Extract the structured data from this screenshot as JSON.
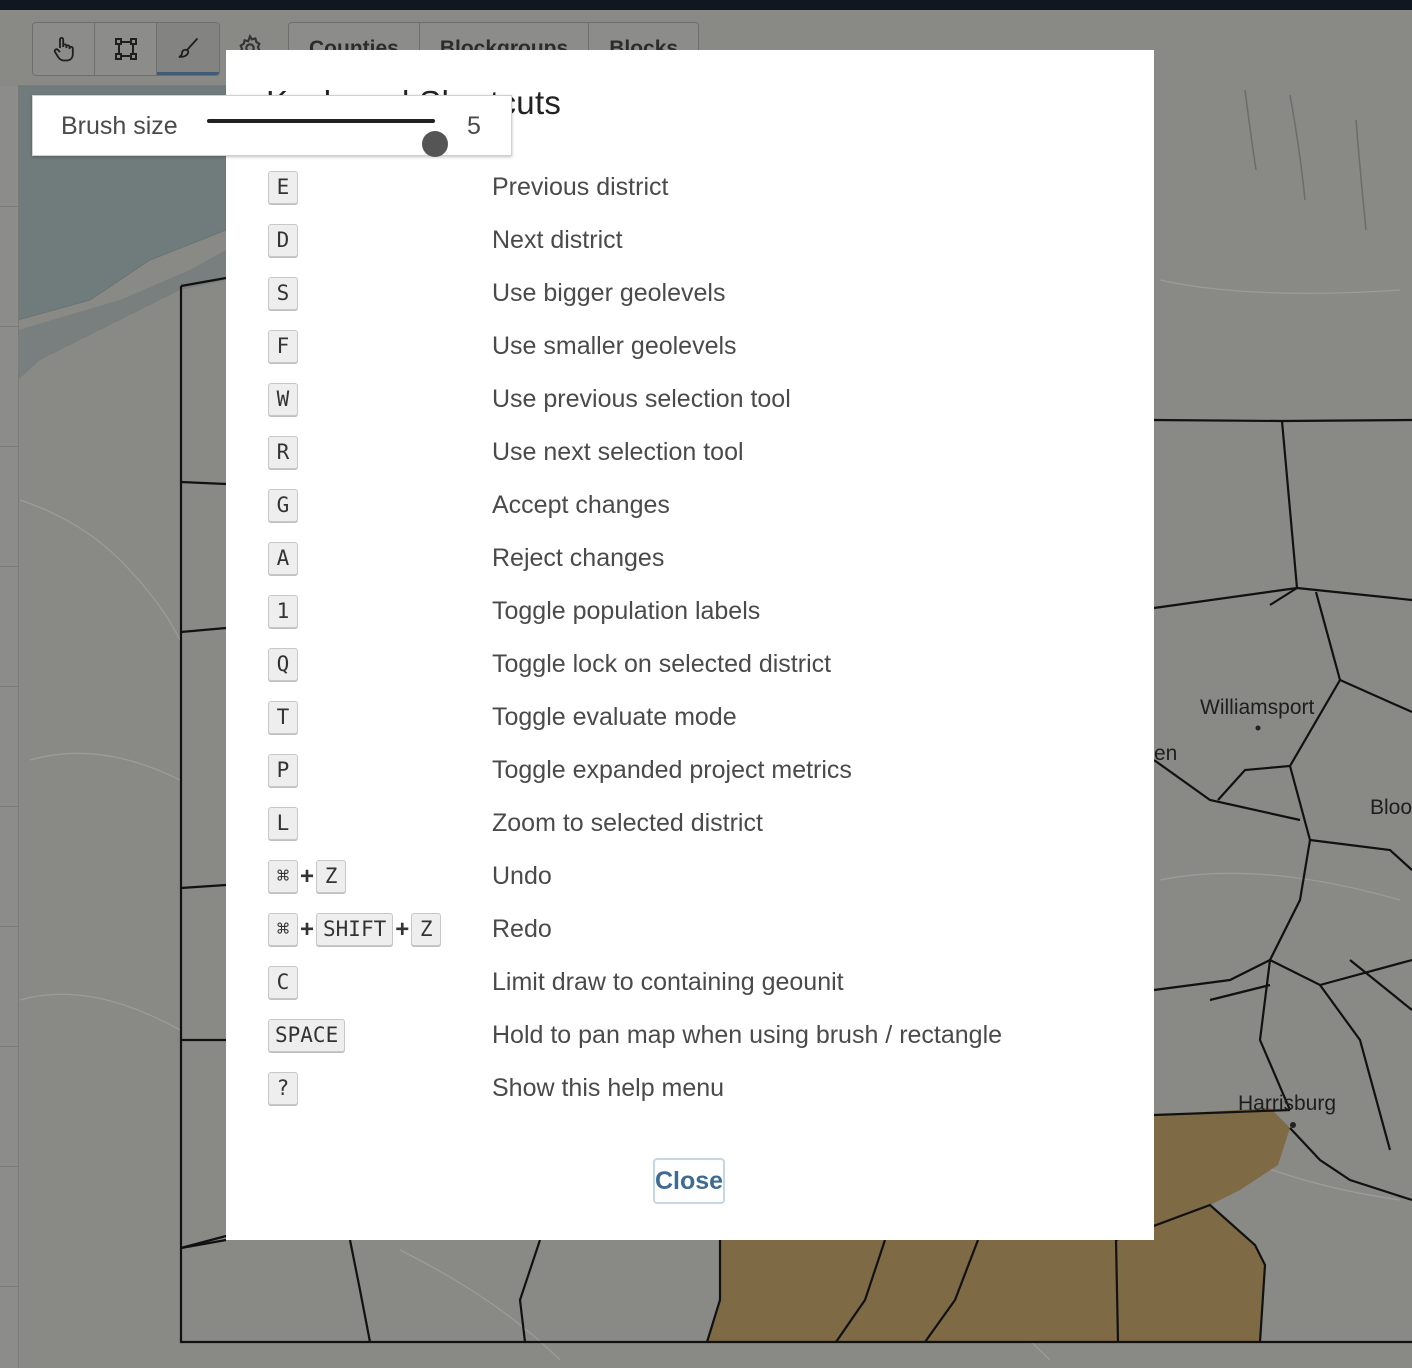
{
  "toolbar": {
    "tools": [
      {
        "name": "pan-tool",
        "icon": "hand-pointer-icon",
        "active": false
      },
      {
        "name": "rectangle-tool",
        "icon": "rectangle-select-icon",
        "active": false
      },
      {
        "name": "brush-tool",
        "icon": "paintbrush-icon",
        "active": true
      }
    ],
    "settings_icon": "gear-icon",
    "geolevels": [
      "Counties",
      "Blockgroups",
      "Blocks"
    ]
  },
  "map": {
    "labels": [
      {
        "text": "Williamsport"
      },
      {
        "text": "Bloo"
      },
      {
        "text": "Harrisburg"
      },
      {
        "text": "en"
      }
    ],
    "colors": {
      "background": "#898986",
      "water": "#707b7c",
      "district": "#7e6a45",
      "boundary": "#111111"
    }
  },
  "modal": {
    "title": "Keyboard Shortcuts",
    "shortcuts": [
      {
        "keys": [
          "E"
        ],
        "description": "Previous district"
      },
      {
        "keys": [
          "D"
        ],
        "description": "Next district"
      },
      {
        "keys": [
          "S"
        ],
        "description": "Use bigger geolevels"
      },
      {
        "keys": [
          "F"
        ],
        "description": "Use smaller geolevels"
      },
      {
        "keys": [
          "W"
        ],
        "description": "Use previous selection tool"
      },
      {
        "keys": [
          "R"
        ],
        "description": "Use next selection tool"
      },
      {
        "keys": [
          "G"
        ],
        "description": "Accept changes"
      },
      {
        "keys": [
          "A"
        ],
        "description": "Reject changes"
      },
      {
        "keys": [
          "1"
        ],
        "description": "Toggle population labels"
      },
      {
        "keys": [
          "Q"
        ],
        "description": "Toggle lock on selected district"
      },
      {
        "keys": [
          "T"
        ],
        "description": "Toggle evaluate mode"
      },
      {
        "keys": [
          "P"
        ],
        "description": "Toggle expanded project metrics"
      },
      {
        "keys": [
          "L"
        ],
        "description": "Zoom to selected district"
      },
      {
        "keys": [
          "⌘",
          "Z"
        ],
        "description": "Undo"
      },
      {
        "keys": [
          "⌘",
          "SHIFT",
          "Z"
        ],
        "description": "Redo"
      },
      {
        "keys": [
          "C"
        ],
        "description": "Limit draw to containing geounit"
      },
      {
        "keys": [
          "SPACE"
        ],
        "description": "Hold to pan map when using brush / rectangle"
      },
      {
        "keys": [
          "?"
        ],
        "description": "Show this help menu"
      }
    ],
    "close_label": "Close",
    "key_separator": "+"
  },
  "brush": {
    "label": "Brush size",
    "value": "5",
    "min": 1,
    "max": 5
  }
}
